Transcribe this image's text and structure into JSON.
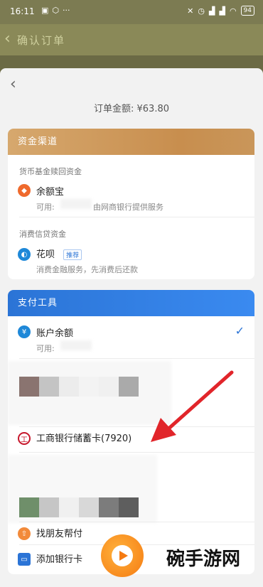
{
  "status_bar": {
    "time": "16:11",
    "more": "···",
    "battery": "94"
  },
  "background_header": {
    "back_glyph": "‹",
    "title": "确认订单"
  },
  "sheet": {
    "back_glyph": "‹",
    "order_amount": "订单金额: ¥63.80"
  },
  "funding": {
    "header": "资金渠道",
    "money_fund_label": "货币基金赎回资金",
    "yuebao_name": "余额宝",
    "yuebao_available_prefix": "可用:",
    "yuebao_service": "由网商银行提供服务",
    "credit_label": "消费信贷资金",
    "huabei_name": "花呗",
    "huabei_tag": "推荐",
    "huabei_desc": "消费金融服务，先消费后还款"
  },
  "payment": {
    "header": "支付工具",
    "balance_name": "账户余额",
    "balance_available_prefix": "可用:",
    "icbc_card": "工商银行储蓄卡(7920)",
    "find_friend": "找朋友帮付",
    "add_bank": "添加银行卡"
  },
  "watermark": {
    "text": "碗手游网"
  },
  "colors": {
    "fund_header": "#c88e4e",
    "pay_header": "#2b74d6",
    "red_arrow": "#e1252a"
  },
  "icons": {
    "yuebao": "yuebao-icon",
    "huabei": "huabei-icon",
    "balance": "yuan-icon",
    "icbc": "icbc-icon",
    "check": "checkmark-icon"
  }
}
